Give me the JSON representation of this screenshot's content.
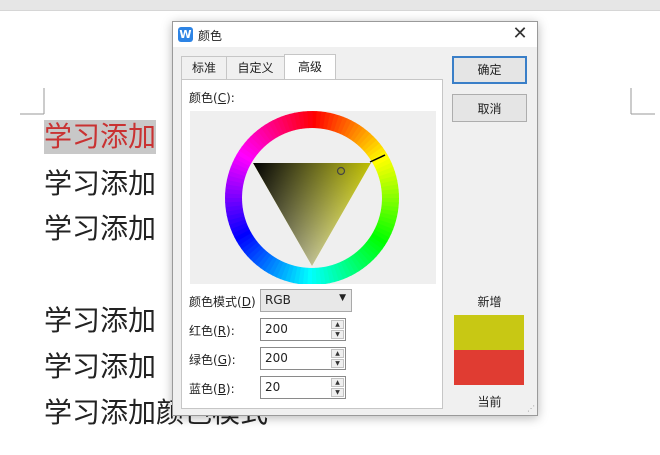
{
  "document": {
    "lines": [
      "学习添加",
      "学习添加",
      "学习添加",
      "学习添加",
      "学习添加",
      "学习添加颜色模式"
    ]
  },
  "dialog": {
    "app_icon": "W",
    "title": "颜色",
    "close_glyph": "✕",
    "tabs": [
      {
        "label": "标准"
      },
      {
        "label": "自定义"
      },
      {
        "label": "高级"
      }
    ],
    "active_tab": "高级",
    "color_label": "颜色(C):",
    "color_label_main": "颜色(",
    "color_label_key": "C",
    "color_label_end": "):",
    "mode_label_main": "颜色模式(",
    "mode_label_key": "D",
    "mode_label_end": ")",
    "mode_value": "RGB",
    "fields": [
      {
        "label_main": "红色(",
        "key": "R",
        "label_end": "):",
        "value": "200"
      },
      {
        "label_main": "绿色(",
        "key": "G",
        "label_end": "):",
        "value": "200"
      },
      {
        "label_main": "蓝色(",
        "key": "B",
        "label_end": "):",
        "value": "20"
      }
    ],
    "ok_label": "确定",
    "cancel_label": "取消",
    "new_label": "新增",
    "current_label": "当前",
    "new_color": "#c8c814",
    "current_color": "#e03c32"
  }
}
